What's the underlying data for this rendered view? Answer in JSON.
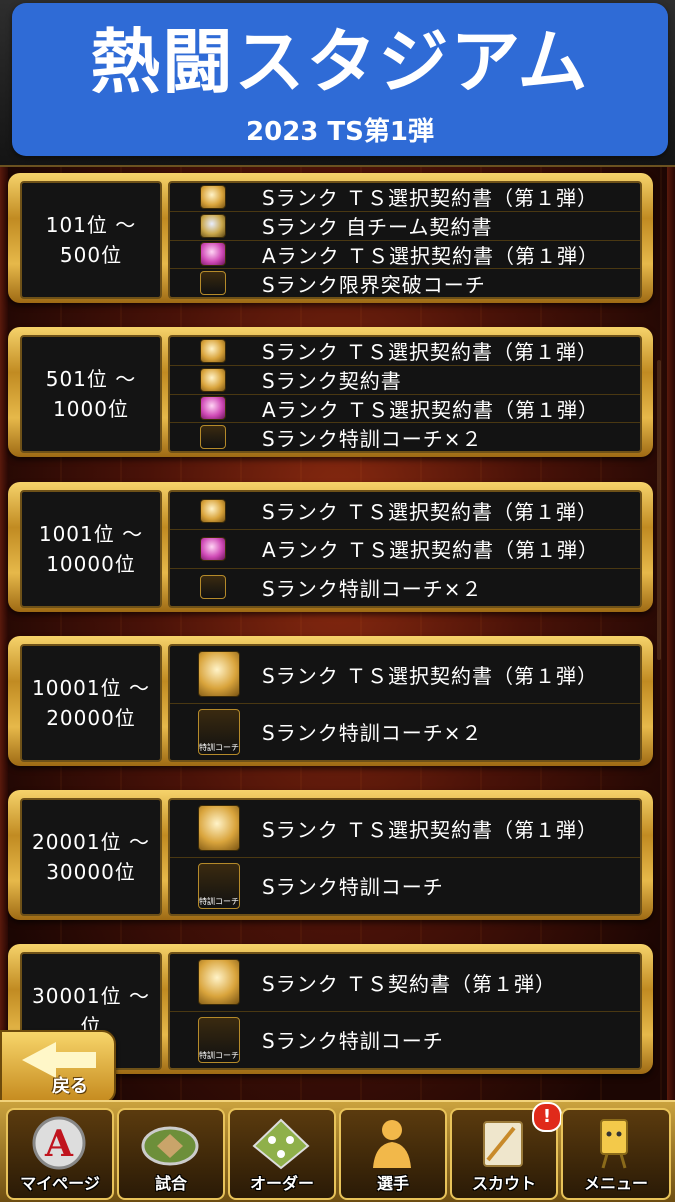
{
  "banner": {
    "title": "熱闘スタジアム",
    "subtitle": "2023 TS第1弾"
  },
  "tiers": [
    {
      "rank_line1": "101位 ～",
      "rank_line2": "500位",
      "rewards": [
        {
          "icon": "s-rank-ts-contract-icon",
          "label": "Sランク ＴＳ選択契約書（第１弾）"
        },
        {
          "icon": "s-rank-team-contract-icon",
          "label": "Sランク 自チーム契約書"
        },
        {
          "icon": "a-rank-ts-contract-icon",
          "label": "Aランク ＴＳ選択契約書（第１弾）"
        },
        {
          "icon": "limit-break-coach-icon",
          "label": "Sランク限界突破コーチ"
        }
      ]
    },
    {
      "rank_line1": "501位 ～",
      "rank_line2": "1000位",
      "rewards": [
        {
          "icon": "s-rank-ts-contract-icon",
          "label": "Sランク ＴＳ選択契約書（第１弾）"
        },
        {
          "icon": "s-rank-contract-icon",
          "label": "Sランク契約書"
        },
        {
          "icon": "a-rank-ts-contract-icon",
          "label": "Aランク ＴＳ選択契約書（第１弾）"
        },
        {
          "icon": "training-coach-icon",
          "label": "Sランク特訓コーチ×２"
        }
      ]
    },
    {
      "rank_line1": "1001位 ～",
      "rank_line2": "10000位",
      "rewards": [
        {
          "icon": "s-rank-ts-contract-icon",
          "label": "Sランク ＴＳ選択契約書（第１弾）"
        },
        {
          "icon": "a-rank-ts-contract-icon",
          "label": "Aランク ＴＳ選択契約書（第１弾）"
        },
        {
          "icon": "training-coach-icon",
          "label": "Sランク特訓コーチ×２"
        }
      ]
    },
    {
      "rank_line1": "10001位 ～",
      "rank_line2": "20000位",
      "rewards": [
        {
          "icon": "s-rank-ts-contract-icon",
          "label": "Sランク ＴＳ選択契約書（第１弾）"
        },
        {
          "icon": "training-coach-icon",
          "label": "Sランク特訓コーチ×２"
        }
      ]
    },
    {
      "rank_line1": "20001位 ～",
      "rank_line2": "30000位",
      "rewards": [
        {
          "icon": "s-rank-ts-contract-icon",
          "label": "Sランク ＴＳ選択契約書（第１弾）"
        },
        {
          "icon": "training-coach-icon",
          "label": "Sランク特訓コーチ"
        }
      ]
    },
    {
      "rank_line1": "30001位 ～",
      "rank_line2": "位",
      "rewards": [
        {
          "icon": "s-rank-ts-contract-icon",
          "label": "Sランク ＴＳ契約書（第１弾）"
        },
        {
          "icon": "training-coach-icon",
          "label": "Sランク特訓コーチ"
        }
      ]
    }
  ],
  "coach_tag": "特訓コーチ",
  "back_button": {
    "label": "戻る"
  },
  "nav": [
    {
      "id": "mypage",
      "label": "マイページ",
      "icon": "a-logo-icon"
    },
    {
      "id": "game",
      "label": "試合",
      "icon": "stadium-icon"
    },
    {
      "id": "order",
      "label": "オーダー",
      "icon": "field-order-icon"
    },
    {
      "id": "players",
      "label": "選手",
      "icon": "player-icon"
    },
    {
      "id": "scout",
      "label": "スカウト",
      "icon": "scout-notebook-icon",
      "badge": "!"
    },
    {
      "id": "menu",
      "label": "メニュー",
      "icon": "menu-character-icon"
    }
  ]
}
